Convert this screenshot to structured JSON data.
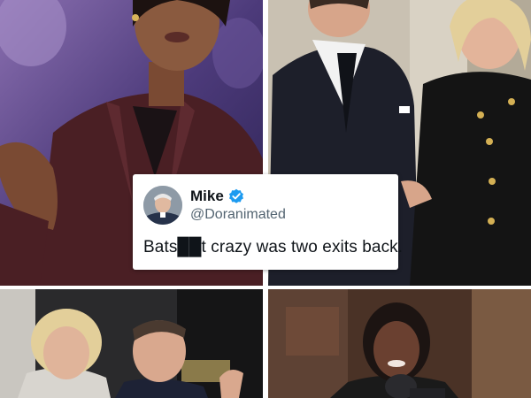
{
  "tweet": {
    "name": "Mike",
    "handle": "@Doranimated",
    "text": "Bats██t crazy was two exits back.",
    "verified": true
  },
  "photos": [
    {
      "name": "photo-top-left",
      "description_icon": "woman-speaking-photo"
    },
    {
      "name": "photo-top-right",
      "description_icon": "couple-standing-photo"
    },
    {
      "name": "photo-bottom-left",
      "description_icon": "couple-waving-photo"
    },
    {
      "name": "photo-bottom-right",
      "description_icon": "woman-microphone-photo"
    }
  ],
  "colors": {
    "verified_badge": "#1d9bf0",
    "name_text": "#0f1419",
    "handle_text": "#536471",
    "suit_burgundy": "#4a1f24",
    "navy_suit": "#1d1f2a"
  }
}
